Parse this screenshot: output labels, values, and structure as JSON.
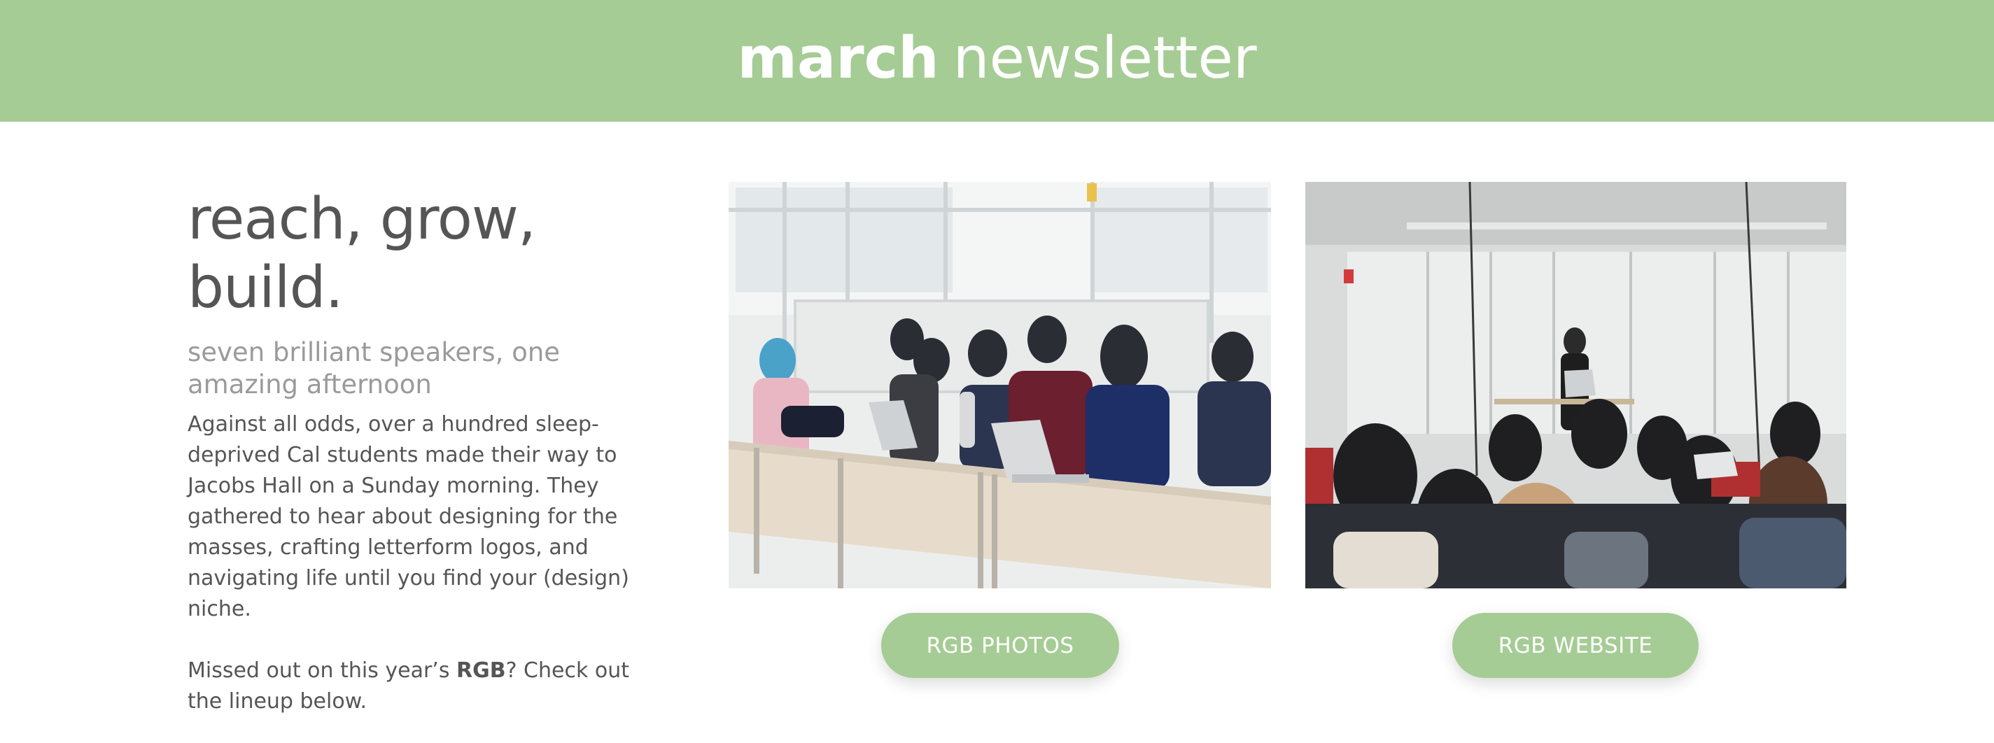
{
  "header": {
    "title_bold": "march",
    "title_light": "newsletter"
  },
  "intro": {
    "headline_line1": "reach, grow,",
    "headline_line2": "build.",
    "subheading": "seven brilliant speakers, one amazing afternoon",
    "paragraph1": "Against all odds, over a hundred sleep-deprived Cal students made their way to Jacobs Hall on a Sunday morning. They gathered to hear about designing for the masses, crafting letterform logos, and navigating life until you find your (design) niche.",
    "paragraph2_before": "Missed out on this year’s ",
    "paragraph2_strong": "RGB",
    "paragraph2_after": "? Check out the lineup below."
  },
  "buttons": {
    "photos_label": "RGB PHOTOS",
    "website_label": "RGB WEBSITE"
  },
  "colors": {
    "accent": "#a5cc94",
    "text": "#555555",
    "muted": "#9a9a9a"
  }
}
